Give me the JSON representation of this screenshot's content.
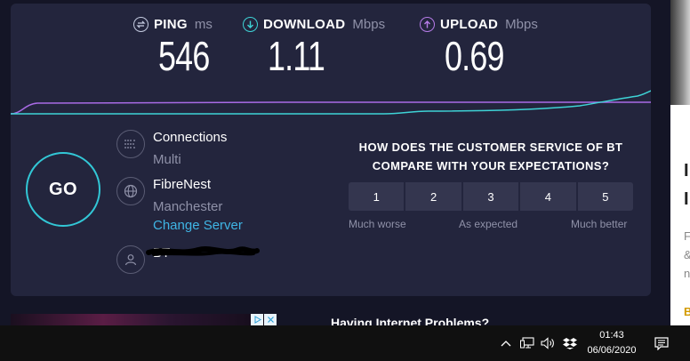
{
  "metrics": {
    "ping": {
      "label": "PING",
      "unit": "ms",
      "value": "546",
      "color": "#c4cbe0"
    },
    "download": {
      "label": "DOWNLOAD",
      "unit": "Mbps",
      "value": "1.11",
      "color": "#3ed3d6"
    },
    "upload": {
      "label": "UPLOAD",
      "unit": "Mbps",
      "value": "0.69",
      "color": "#b67ce8"
    }
  },
  "graph": {
    "download_color": "#3ed3d6",
    "upload_color": "#a96be6"
  },
  "go_button": "GO",
  "connections": {
    "title": "Connections",
    "mode": "Multi",
    "icon": "connections-icon"
  },
  "server": {
    "name": "FibreNest",
    "location": "Manchester",
    "change_link": "Change Server",
    "icon": "globe-icon"
  },
  "isp": {
    "name": "BT",
    "icon": "user-icon"
  },
  "survey": {
    "question_line1": "HOW DOES THE CUSTOMER SERVICE OF BT",
    "question_line2": "COMPARE WITH YOUR EXPECTATIONS?",
    "ratings": [
      "1",
      "2",
      "3",
      "4",
      "5"
    ],
    "low_label": "Much worse",
    "mid_label": "As expected",
    "high_label": "Much better"
  },
  "side_page": {
    "letters": [
      "I",
      "I"
    ],
    "small": [
      "F",
      "&",
      "n"
    ],
    "brand_letter": "B"
  },
  "below": {
    "heading": "Having Internet Problems?"
  },
  "taskbar": {
    "time": "01:43",
    "date": "06/06/2020"
  },
  "colors": {
    "panel": "#23253d",
    "background": "#141526",
    "accent_link": "#3fb5e5",
    "go_ring": "#32c7d6"
  }
}
